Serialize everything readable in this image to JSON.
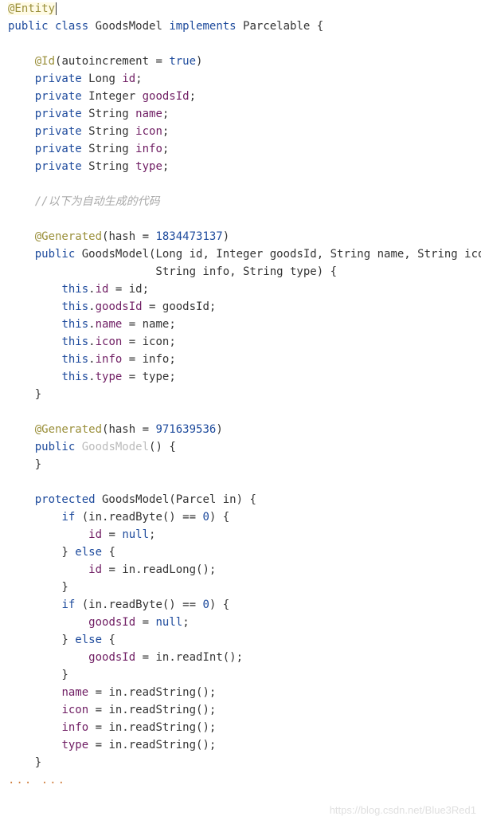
{
  "l1": "@Entity",
  "l2": "public class GoodsModel implements Parcelable {",
  "l4": "    @Id(autoincrement = true)",
  "l5": "    private Long id;",
  "l6": "    private Integer goodsId;",
  "l7": "    private String name;",
  "l8": "    private String icon;",
  "l9": "    private String info;",
  "l10": "    private String type;",
  "l12": "    //以下为自动生成的代码",
  "l14": "    @Generated(hash = 1834473137)",
  "l15": "    public GoodsModel(Long id, Integer goodsId, String name, String icon,",
  "l16": "                      String info, String type) {",
  "l17": "        this.id = id;",
  "l18": "        this.goodsId = goodsId;",
  "l19": "        this.name = name;",
  "l20": "        this.icon = icon;",
  "l21": "        this.info = info;",
  "l22": "        this.type = type;",
  "l23": "    }",
  "l25": "    @Generated(hash = 971639536)",
  "l26": "    public GoodsModel() {",
  "l27": "    }",
  "l29": "    protected GoodsModel(Parcel in) {",
  "l30": "        if (in.readByte() == 0) {",
  "l31": "            id = null;",
  "l32": "        } else {",
  "l33": "            id = in.readLong();",
  "l34": "        }",
  "l35": "        if (in.readByte() == 0) {",
  "l36": "            goodsId = null;",
  "l37": "        } else {",
  "l38": "            goodsId = in.readInt();",
  "l39": "        }",
  "l40": "        name = in.readString();",
  "l41": "        icon = in.readString();",
  "l42": "        info = in.readString();",
  "l43": "        type = in.readString();",
  "l44": "    }",
  "ellipsis": "... ...",
  "watermark": "https://blog.csdn.net/Blue3Red1"
}
